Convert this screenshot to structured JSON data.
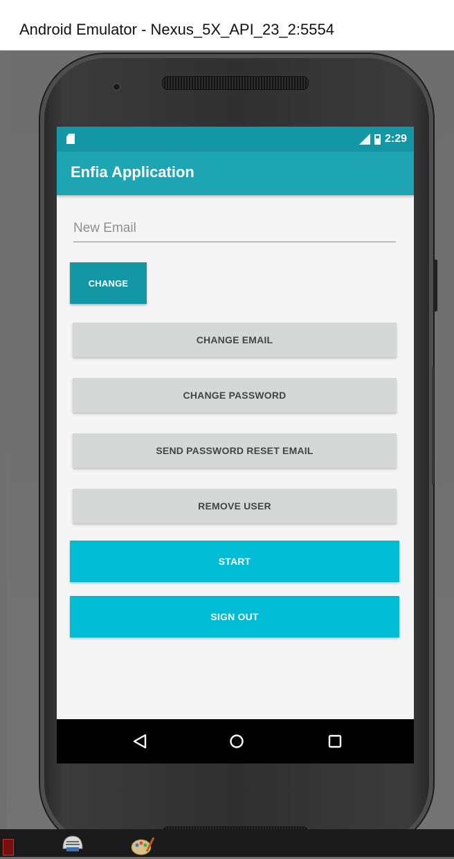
{
  "window": {
    "title": "Android Emulator - Nexus_5X_API_23_2:5554"
  },
  "statusbar": {
    "time": "2:29"
  },
  "app": {
    "title": "Enfia Application"
  },
  "form": {
    "email_placeholder": "New Email",
    "email_value": ""
  },
  "buttons": {
    "change": "CHANGE",
    "change_email": "CHANGE EMAIL",
    "change_password": "CHANGE PASSWORD",
    "send_reset": "SEND PASSWORD RESET EMAIL",
    "remove_user": "REMOVE USER",
    "start": "START",
    "sign_out": "SIGN OUT"
  },
  "colors": {
    "appbar": "#1ea5b3",
    "statusbar": "#1497a4",
    "primary_button": "#00bcd4",
    "secondary_button": "#d6d7d7"
  },
  "navbar": {
    "icons": [
      "back-icon",
      "home-icon",
      "recents-icon"
    ]
  },
  "taskbar": {
    "icons": [
      "app-icon",
      "helmet-icon",
      "paint-icon"
    ]
  }
}
